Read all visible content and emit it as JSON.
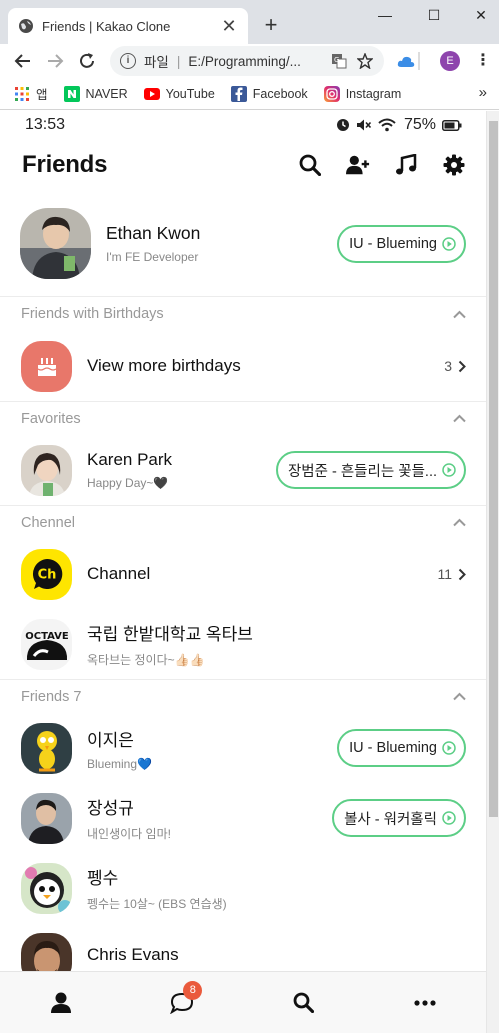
{
  "browser": {
    "tab_title": "Friends | Kakao Clone",
    "tab_close": "✕",
    "new_tab": "+",
    "window_controls": {
      "minimize": "—",
      "maximize": "☐",
      "close": "✕"
    },
    "omnibox": {
      "scheme_label": "파일",
      "url": "E:/Programming/..."
    },
    "bookmarks": [
      {
        "label": "앱",
        "icon": "apps-grid-icon"
      },
      {
        "label": "NAVER",
        "icon": "naver-icon"
      },
      {
        "label": "YouTube",
        "icon": "youtube-icon"
      },
      {
        "label": "Facebook",
        "icon": "facebook-icon"
      },
      {
        "label": "Instagram",
        "icon": "instagram-icon"
      }
    ],
    "bookmarks_more": "»",
    "profile_initial": "E",
    "menu": "⋮"
  },
  "status_bar": {
    "time": "13:53",
    "battery": "75%"
  },
  "header": {
    "title": "Friends"
  },
  "me": {
    "name": "Ethan Kwon",
    "status": "I'm FE Developer",
    "music": "IU - Blueming"
  },
  "sections": {
    "birthdays": {
      "title": "Friends with Birthdays",
      "item_label": "View more birthdays",
      "count": "3"
    },
    "favorites": {
      "title": "Favorites"
    },
    "channel": {
      "title": "Chennel"
    },
    "friends": {
      "title": "Friends 7"
    }
  },
  "favorites": [
    {
      "name": "Karen Park",
      "status": "Happy Day~🖤",
      "music": "장범준 - 흔들리는 꽃들..."
    }
  ],
  "channels": [
    {
      "name": "Channel",
      "count": "11"
    },
    {
      "name": "국립 한밭대학교 옥타브",
      "status": "옥타브는 정이다~👍🏻👍🏻"
    }
  ],
  "channel_logo_text": {
    "ch": "Ch",
    "octave": "OCTAVE"
  },
  "friends": [
    {
      "name": "이지은",
      "status": "Blueming💙",
      "music": "IU - Blueming"
    },
    {
      "name": "장성규",
      "status": "내인생이다 임마!",
      "music": "볼사 - 워커홀릭"
    },
    {
      "name": "펭수",
      "status": "펭수는 10살~ (EBS 연습생)"
    },
    {
      "name": "Chris Evans",
      "status": ""
    }
  ],
  "bottom_nav": {
    "chat_badge": "8"
  },
  "colors": {
    "accent_green": "#5cce86",
    "birthday_bg": "#e8776a",
    "channel_yellow": "#fee500",
    "badge_red": "#ea5a3c"
  }
}
